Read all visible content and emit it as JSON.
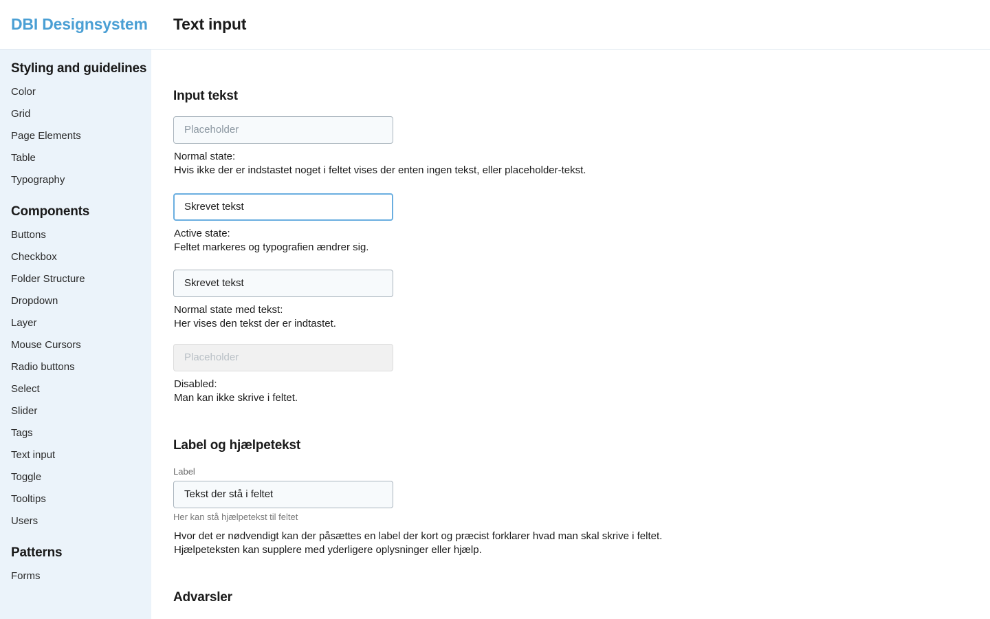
{
  "header": {
    "brand": "DBI Designsystem",
    "title": "Text input",
    "brand_color": "#4a9fd4"
  },
  "sidebar": {
    "sections": [
      {
        "heading": "Styling and guidelines",
        "items": [
          "Color",
          "Grid",
          "Page Elements",
          "Table",
          "Typography"
        ]
      },
      {
        "heading": "Components",
        "items": [
          "Buttons",
          "Checkbox",
          "Folder Structure",
          "Dropdown",
          "Layer",
          "Mouse Cursors",
          "Radio buttons",
          "Select",
          "Slider",
          "Tags",
          "Text input",
          "Toggle",
          "Tooltips",
          "Users"
        ]
      },
      {
        "heading": "Patterns",
        "items": [
          "Forms"
        ]
      }
    ]
  },
  "main": {
    "section1": {
      "heading": "Input tekst",
      "examples": [
        {
          "state": "normal",
          "placeholder": "Placeholder",
          "value": "",
          "caption_title": "Normal state:",
          "caption_text": "Hvis ikke der er indstastet noget i feltet vises der enten ingen tekst, eller placeholder-tekst."
        },
        {
          "state": "active",
          "placeholder": "",
          "value": "Skrevet tekst",
          "caption_title": "Active state:",
          "caption_text": "Feltet markeres og typografien ændrer sig."
        },
        {
          "state": "filled",
          "placeholder": "",
          "value": "Skrevet tekst",
          "caption_title": "Normal state med tekst:",
          "caption_text": "Her vises den tekst der er indtastet."
        },
        {
          "state": "disabled",
          "placeholder": "Placeholder",
          "value": "",
          "caption_title": "Disabled:",
          "caption_text": "Man kan ikke skrive i feltet."
        }
      ]
    },
    "section2": {
      "heading": "Label og hjælpetekst",
      "label": "Label",
      "value": "Tekst der stå i feltet",
      "help_text": "Her kan stå hjælpetekst til feltet",
      "desc_line1": "Hvor det er nødvendigt kan der påsættes en label der kort og præcist forklarer hvad man skal skrive i feltet.",
      "desc_line2": "Hjælpeteksten kan supplere med yderligere oplysninger eller hjælp."
    },
    "section3": {
      "heading": "Advarsler"
    }
  }
}
